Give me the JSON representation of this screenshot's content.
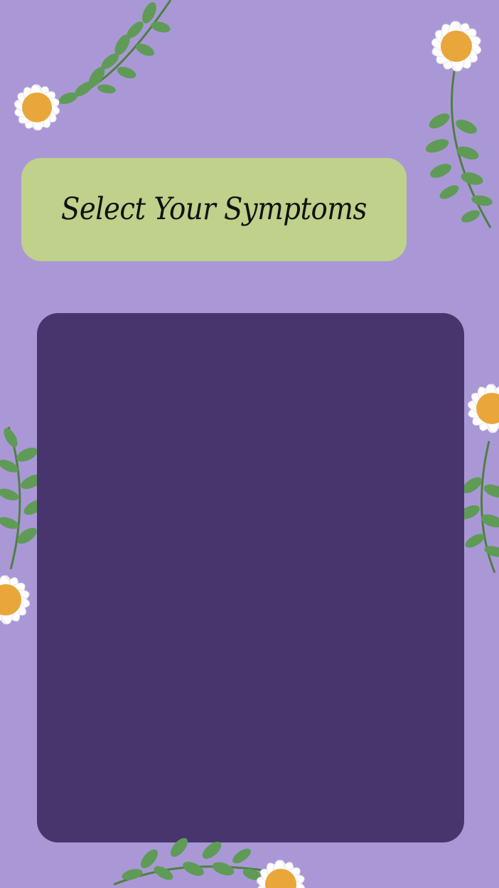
{
  "screen": {
    "title": "Select Your Symptoms"
  },
  "colors": {
    "background": "#aa98d6",
    "title_card": "#bfd18a",
    "panel": "#48356d",
    "petal": "#ffffff",
    "flower_center": "#e9a63b",
    "leaf": "#5f9b57"
  },
  "decorations": {
    "icon_name": "daisy-with-leaves-icon"
  }
}
